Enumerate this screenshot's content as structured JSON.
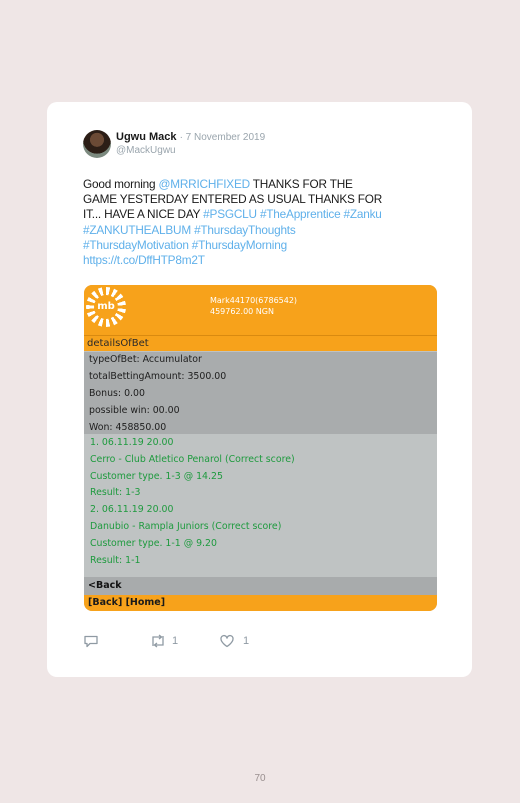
{
  "tweet": {
    "author": "Ugwu Mack",
    "date": "· 7 November 2019",
    "handle": "@MackUgwu",
    "text_lines": [
      [
        {
          "t": "Good morning ",
          "link": false
        },
        {
          "t": "@MRRICHFIXED",
          "link": true
        },
        {
          "t": " THANKS FOR THE",
          "link": false
        }
      ],
      [
        {
          "t": "GAME YESTERDAY ENTERED AS USUAL THANKS FOR",
          "link": false
        }
      ],
      [
        {
          "t": "IT... HAVE A NICE DAY ",
          "link": false
        },
        {
          "t": "#PSGCLU",
          "link": true
        },
        {
          "t": " ",
          "link": false
        },
        {
          "t": "#TheApprentice",
          "link": true
        },
        {
          "t": " ",
          "link": false
        },
        {
          "t": "#Zanku",
          "link": true
        }
      ],
      [
        {
          "t": "#ZANKUTHEALBUM",
          "link": true
        },
        {
          "t": " ",
          "link": false
        },
        {
          "t": "#ThursdayThoughts",
          "link": true
        }
      ],
      [
        {
          "t": "#ThursdayMotivation",
          "link": true
        },
        {
          "t": " ",
          "link": false
        },
        {
          "t": "#ThursdayMorning",
          "link": true
        }
      ],
      [
        {
          "t": "https://t.co/DffHTP8m2T",
          "link": true
        }
      ]
    ],
    "retweets": "1",
    "likes": "1"
  },
  "screenshot": {
    "logo_text": "mb",
    "account_id": "Mark44170(6786542)",
    "balance": "459762.00 NGN",
    "details_title": "detailsOfBet",
    "summary": [
      "typeOfBet: Accumulator",
      "totalBettingAmount:  3500.00",
      "Bonus: 0.00",
      "possible win: 00.00",
      "Won:  458850.00"
    ],
    "bets": [
      "1. 06.11.19  20.00",
      "Cerro - Club Atletico Penarol (Correct score)",
      "Customer type. 1-3 @ 14.25",
      "Result: 1-3",
      "2. 06.11.19  20.00",
      "Danubio - Rampla Juniors (Correct score)",
      "Customer type. 1-1 @   9.20",
      "Result: 1-1"
    ],
    "back_label": "<Back",
    "nav_label": "[Back] [Home]"
  },
  "page_number": "70",
  "icons": [
    "reply-icon",
    "retweet-icon",
    "like-icon"
  ],
  "colors": {
    "accent": "#f7a21b",
    "link": "#5fb0ea",
    "win_green": "#1e9a3e"
  }
}
